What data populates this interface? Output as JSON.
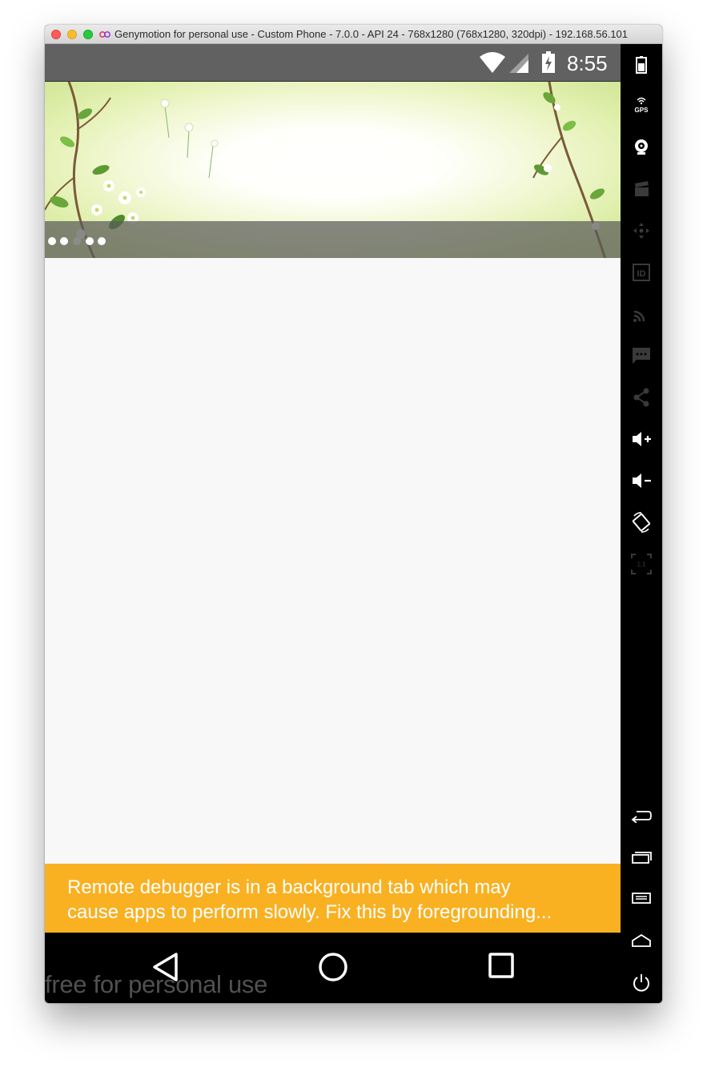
{
  "window": {
    "title": "Genymotion for personal use - Custom Phone - 7.0.0 - API 24 - 768x1280 (768x1280, 320dpi) - 192.168.56.101"
  },
  "statusbar": {
    "time": "8:55",
    "icons": [
      "wifi-icon",
      "cell-signal-icon",
      "battery-charging-icon"
    ]
  },
  "banner": {
    "indicator_count": 5,
    "active_indicator": 3
  },
  "warning": {
    "line1": "Remote debugger is in a background tab which may",
    "line2": "cause apps to perform slowly. Fix this by foregrounding..."
  },
  "watermark": "free for personal use",
  "navbar": {
    "buttons": [
      "back-icon",
      "home-icon",
      "recents-icon"
    ]
  },
  "side_toolbar": {
    "buttons": [
      "battery-icon",
      "gps-icon",
      "camera-icon",
      "clapperboard-icon",
      "dpad-icon",
      "device-id-icon",
      "cast-icon",
      "message-icon",
      "share-icon",
      "volume-up-icon",
      "volume-down-icon",
      "rotate-icon",
      "scale-1to1-icon",
      "back-icon",
      "recent-apps-icon",
      "menu-icon",
      "home-icon",
      "power-icon"
    ],
    "gps_label": "GPS",
    "id_label": "ID",
    "scale_label": "1:1"
  },
  "colors": {
    "statusbar": "#616161",
    "warning_bg": "#f9b122",
    "content_bg": "#f8f8f8",
    "navbar": "#000000"
  }
}
